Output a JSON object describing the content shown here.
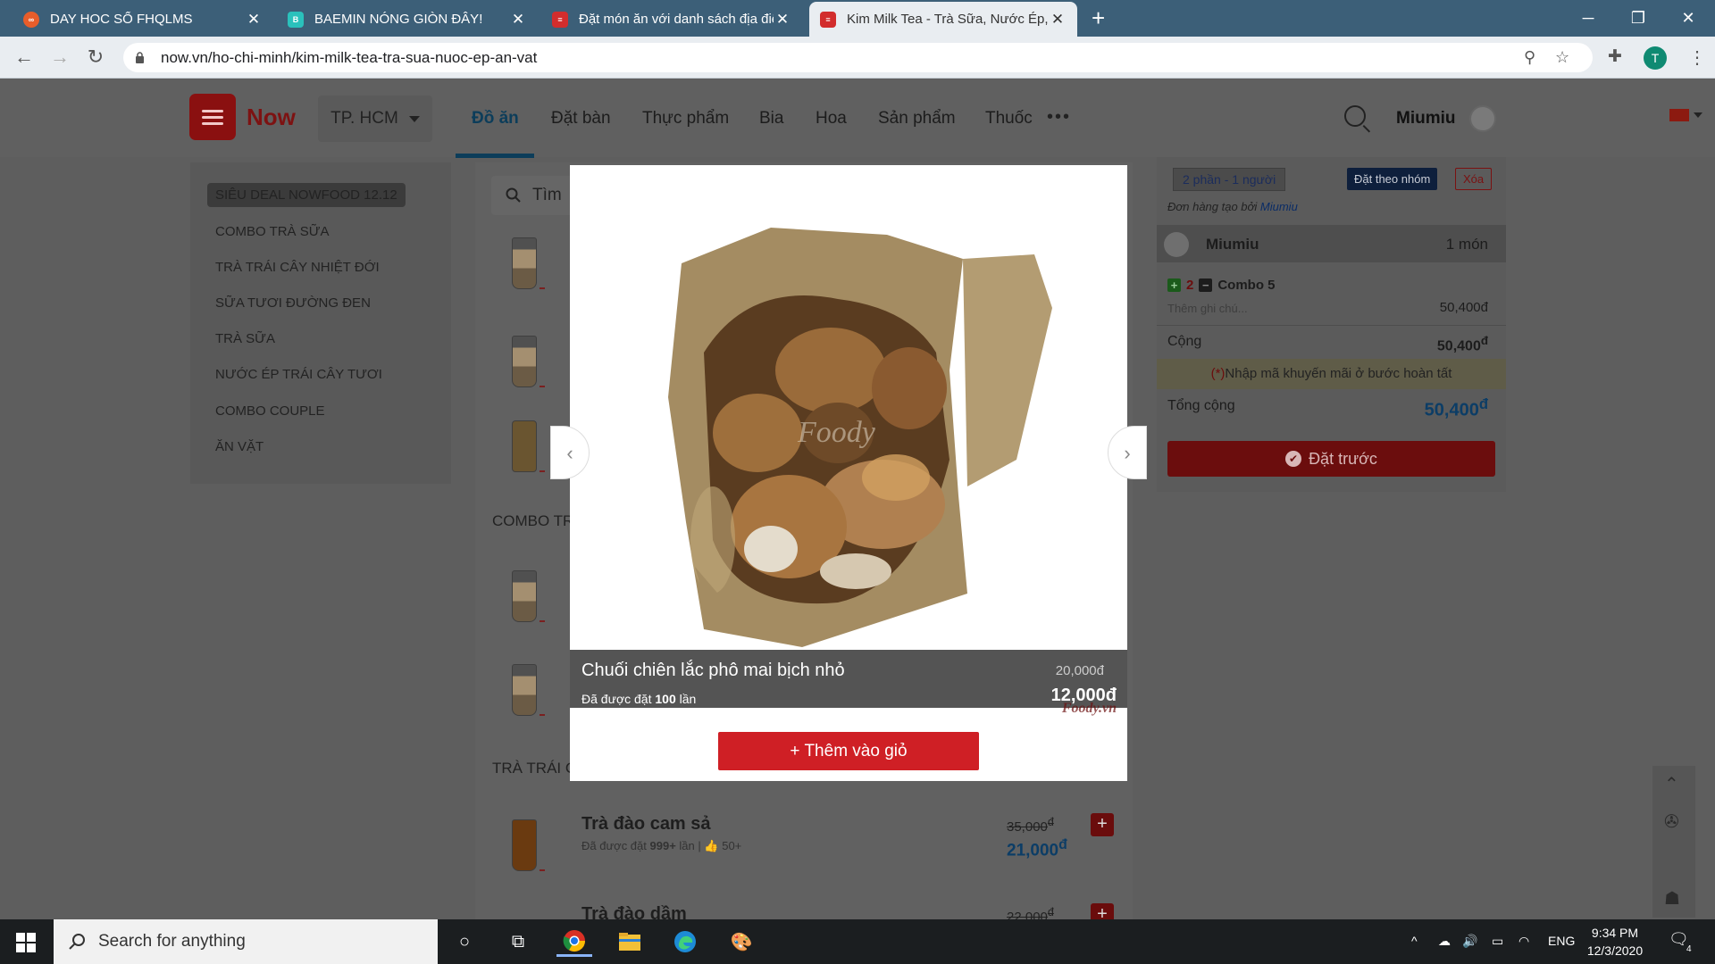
{
  "browser": {
    "tabs": [
      {
        "title": "DAY HOC SỐ FHQLMS",
        "favicon_color": "#e85d2a"
      },
      {
        "title": "BAEMIN NÓNG GIÒN ĐÂY!",
        "favicon_color": "#2ac1bc"
      },
      {
        "title": "Đặt món ăn với danh sách địa điểm",
        "favicon_color": "#d22d2d"
      },
      {
        "title": "Kim Milk Tea - Trà Sữa, Nước Ép, Ăn Vặt",
        "favicon_color": "#d22d2d"
      }
    ],
    "url": "now.vn/ho-chi-minh/kim-milk-tea-tra-sua-nuoc-ep-an-vat",
    "profile_initial": "T"
  },
  "header": {
    "logo_text": "Now",
    "city": "TP. HCM",
    "nav": [
      "Đồ ăn",
      "Đặt bàn",
      "Thực phẩm",
      "Bia",
      "Hoa",
      "Sản phẩm",
      "Thuốc"
    ],
    "active_nav": "Đồ ăn",
    "user": "Miumiu"
  },
  "menu": {
    "highlight": "SIÊU DEAL NOWFOOD 12.12",
    "items": [
      "COMBO TRÀ SỮA",
      "TRÀ TRÁI CÂY NHIỆT ĐỚI",
      "SỮA TƯƠI ĐƯỜNG ĐEN",
      "TRÀ SỮA",
      "NƯỚC ÉP TRÁI CÂY TƯƠI",
      "COMBO COUPLE",
      "ĂN VẶT"
    ]
  },
  "listing": {
    "search_placeholder": "Tìm",
    "section_combo": "COMBO TR",
    "section_fruit": "TRÀ TRÁI C",
    "items": [
      {
        "name": "Trà đào cam sả",
        "ordered_prefix": "Đã được đặt",
        "ordered_count": "999+",
        "ordered_suffix": "lần",
        "likes": "50+",
        "old_price": "35,000",
        "price": "21,000",
        "currency": "đ"
      },
      {
        "name": "Trà đào dầm",
        "old_price": "22,000",
        "currency": "đ"
      }
    ]
  },
  "cart": {
    "parts": "2 phần",
    "people": "1 người",
    "group_button": "Đặt theo nhóm",
    "clear_button": "Xóa",
    "created_by_label": "Đơn hàng tạo bởi",
    "created_by_user": "Miumiu",
    "user_row_name": "Miumiu",
    "user_row_count": "1 món",
    "line_qty": "2",
    "line_name": "Combo 5",
    "note_placeholder": "Thêm ghi chú...",
    "line_price": "50,400đ",
    "subtotal_label": "Cộng",
    "subtotal": "50,400",
    "promo_star": "(*)",
    "promo_text": "Nhập mã khuyến mãi ở bước hoàn tất",
    "total_label": "Tổng cộng",
    "total": "50,400",
    "currency": "đ",
    "order_button": "Đặt trước"
  },
  "modal": {
    "product_name": "Chuối chiên lắc phô mai bịch nhỏ",
    "ordered_prefix": "Đã được đặt",
    "ordered_count": "100",
    "ordered_suffix": "lần",
    "old_price": "20,000đ",
    "price": "12,000đ",
    "add_to_cart": "+ Thêm vào giỏ",
    "watermark": "Foody",
    "watermark_corner": "Foody.vn"
  },
  "taskbar": {
    "search_placeholder": "Search for anything",
    "language": "ENG",
    "time": "9:34 PM",
    "date": "12/3/2020",
    "notifications": "4"
  }
}
